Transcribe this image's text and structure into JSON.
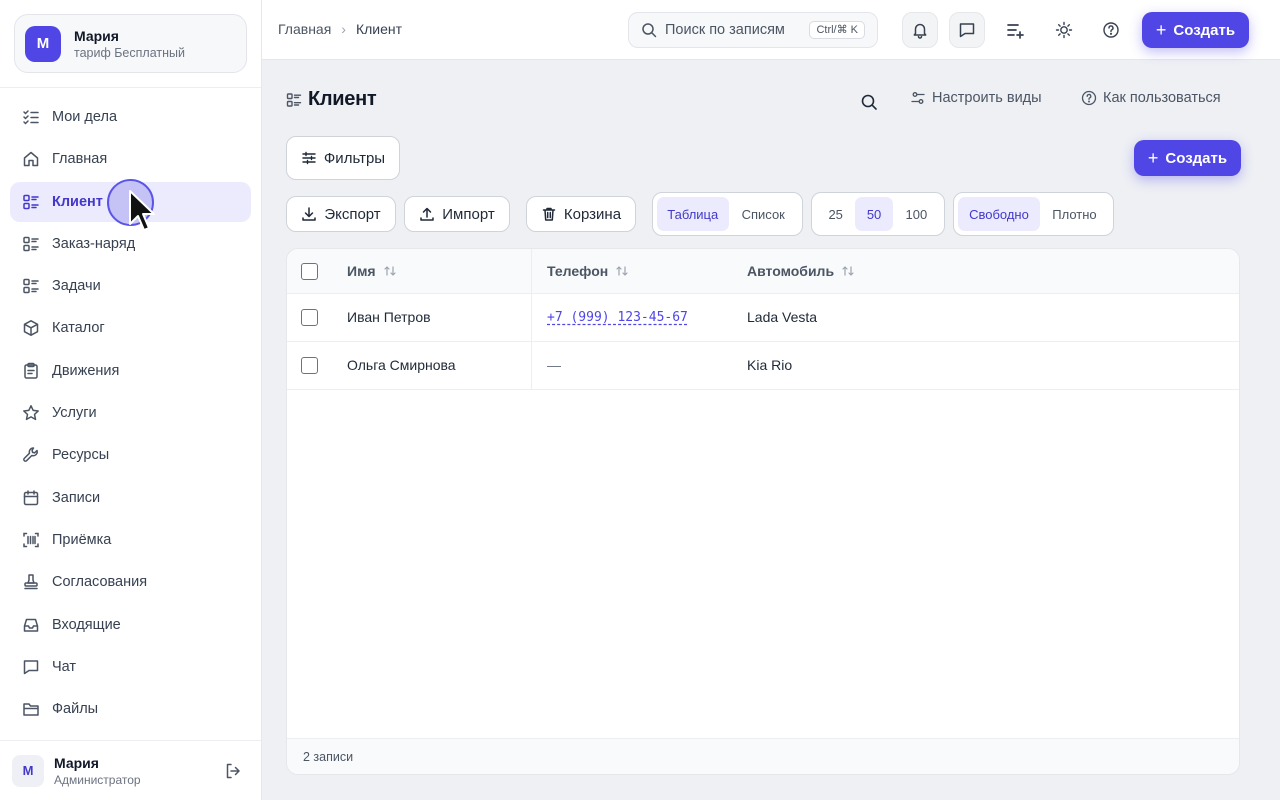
{
  "account": {
    "avatar_letter": "М",
    "name": "Мария",
    "plan": "тариф Бесплатный"
  },
  "nav": [
    {
      "label": "Мои дела",
      "icon": "list-check-icon"
    },
    {
      "label": "Главная",
      "icon": "home-icon"
    },
    {
      "label": "Клиент",
      "icon": "list-grid-icon",
      "active": true
    },
    {
      "label": "Заказ-наряд",
      "icon": "list-grid-icon"
    },
    {
      "label": "Задачи",
      "icon": "list-grid-icon"
    },
    {
      "label": "Каталог",
      "icon": "box-icon"
    },
    {
      "label": "Движения",
      "icon": "clipboard-icon"
    },
    {
      "label": "Услуги",
      "icon": "star-icon"
    },
    {
      "label": "Ресурсы",
      "icon": "wrench-icon"
    },
    {
      "label": "Записи",
      "icon": "calendar-icon"
    },
    {
      "label": "Приёмка",
      "icon": "barcode-scan-icon"
    },
    {
      "label": "Согласования",
      "icon": "stamp-icon"
    },
    {
      "label": "Входящие",
      "icon": "inbox-icon"
    },
    {
      "label": "Чат",
      "icon": "chat-icon"
    },
    {
      "label": "Файлы",
      "icon": "folder-icon"
    }
  ],
  "user": {
    "avatar_letter": "М",
    "name": "Мария",
    "role": "Администратор"
  },
  "breadcrumb": {
    "home": "Главная",
    "current": "Клиент"
  },
  "search": {
    "placeholder": "Поиск по записям",
    "shortcut": "Ctrl/⌘ K"
  },
  "topbar": {
    "create_label": "Создать"
  },
  "page": {
    "title": "Клиент",
    "configure_views": "Настроить виды",
    "how_to_use": "Как пользоваться",
    "filters": "Фильтры",
    "create": "Создать",
    "export": "Экспорт",
    "import": "Импорт",
    "trash": "Корзина"
  },
  "view_mode": {
    "options": [
      "Таблица",
      "Список"
    ],
    "selected": "Таблица"
  },
  "page_size": {
    "options": [
      "25",
      "50",
      "100"
    ],
    "selected": "50"
  },
  "density": {
    "options": [
      "Свободно",
      "Плотно"
    ],
    "selected": "Свободно"
  },
  "table": {
    "columns": [
      "Имя",
      "Телефон",
      "Автомобиль"
    ],
    "rows": [
      {
        "name": "Иван Петров",
        "phone": "+7 (999) 123-45-67",
        "car": "Lada Vesta"
      },
      {
        "name": "Ольга Смирнова",
        "phone": "—",
        "car": "Kia Rio"
      }
    ],
    "footer": "2 записи"
  },
  "colors": {
    "accent": "#4f46e5",
    "active_bg": "#ebebfd",
    "page_bg": "#eef0f4"
  }
}
